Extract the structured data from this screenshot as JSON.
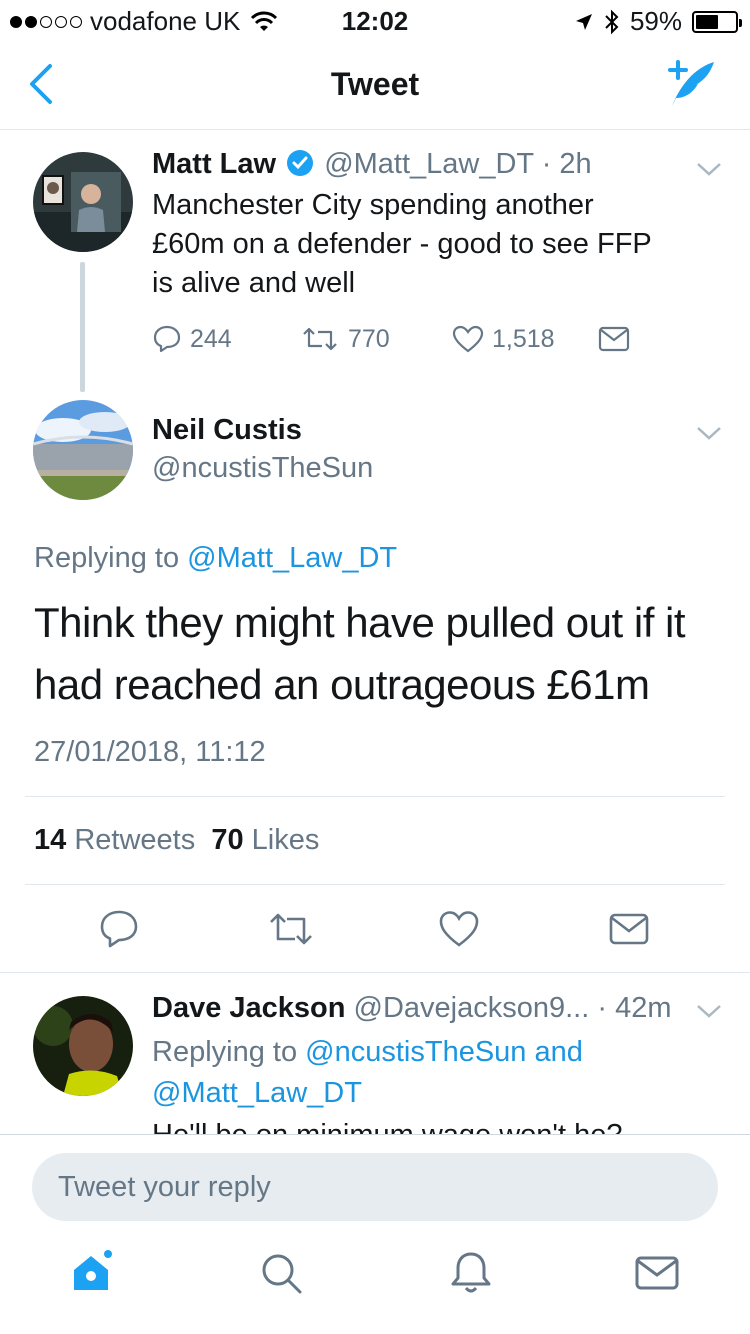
{
  "status_bar": {
    "carrier": "vodafone UK",
    "time": "12:02",
    "battery": "59%",
    "battery_level": 0.59
  },
  "nav": {
    "title": "Tweet"
  },
  "parent_tweet": {
    "name": "Matt Law",
    "verified": true,
    "handle": "@Matt_Law_DT",
    "time": "· 2h",
    "text_lines": [
      "Manchester City spending another",
      "£60m on a defender - good to see FFP",
      "is alive and well"
    ],
    "replies": "244",
    "retweets": "770",
    "likes": "1,518"
  },
  "main_tweet": {
    "name": "Neil Custis",
    "handle": "@ncustisTheSun",
    "replying_prefix": "Replying to ",
    "replying_to": "@Matt_Law_DT",
    "text": "Think they might have pulled out if it had reached an outrageous £61m",
    "date": "27/01/2018, 11:12",
    "retweets_count": "14",
    "retweets_label": "Retweets",
    "likes_count": "70",
    "likes_label": "Likes"
  },
  "reply_tweet": {
    "name": "Dave Jackson",
    "handle": "@Davejackson9...",
    "time": "· 42m",
    "replying_prefix": "Replying to ",
    "replying_to_1": "@ncustisTheSun",
    "replying_and": " and",
    "replying_to_2": "@Matt_Law_DT",
    "text_partial": "He'll be on minimum wage won't he?"
  },
  "reply_box": {
    "placeholder": "Tweet your reply"
  },
  "colors": {
    "accent": "#1da1f2",
    "link": "#1b95e0",
    "muted": "#657786"
  }
}
